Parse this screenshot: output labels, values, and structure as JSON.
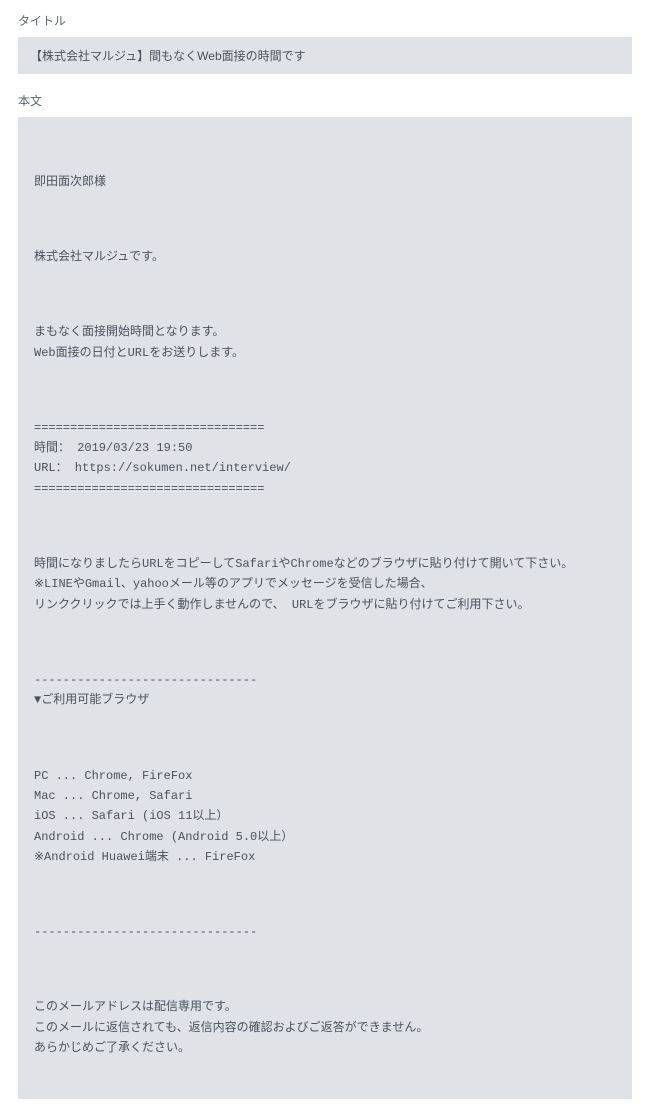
{
  "labels": {
    "title_label": "タイトル",
    "body_label": "本文"
  },
  "title_bar": "【株式会社マルジュ】間もなくWeb面接の時間です",
  "body": {
    "p1": "即田面次郎様",
    "p2": "株式会社マルジュです。",
    "p3": "まもなく面接開始時間となります。\nWeb面接の日付とURLをお送りします。",
    "p4": "================================\n時間： 2019/03/23 19:50\nURL： https://sokumen.net/interview/\n================================",
    "p5": "時間になりましたらURLをコピーしてSafariやChromeなどのブラウザに貼り付けて開いて下さい。\n※LINEやGmail、yahooメール等のアプリでメッセージを受信した場合、\nリンククリックでは上手く動作しませんので、 URLをブラウザに貼り付けてご利用下さい。",
    "p6": "-------------------------------\n▼ご利用可能ブラウザ",
    "p7": "PC ... Chrome, FireFox\nMac ... Chrome, Safari\niOS ... Safari (iOS 11以上）\nAndroid ... Chrome (Android 5.0以上）\n※Android Huawei端末 ... FireFox",
    "p8": "-------------------------------",
    "p9": "このメールアドレスは配信専用です。\nこのメールに返信されても、返信内容の確認およびご返答ができません。\nあらかじめご了承ください。"
  }
}
